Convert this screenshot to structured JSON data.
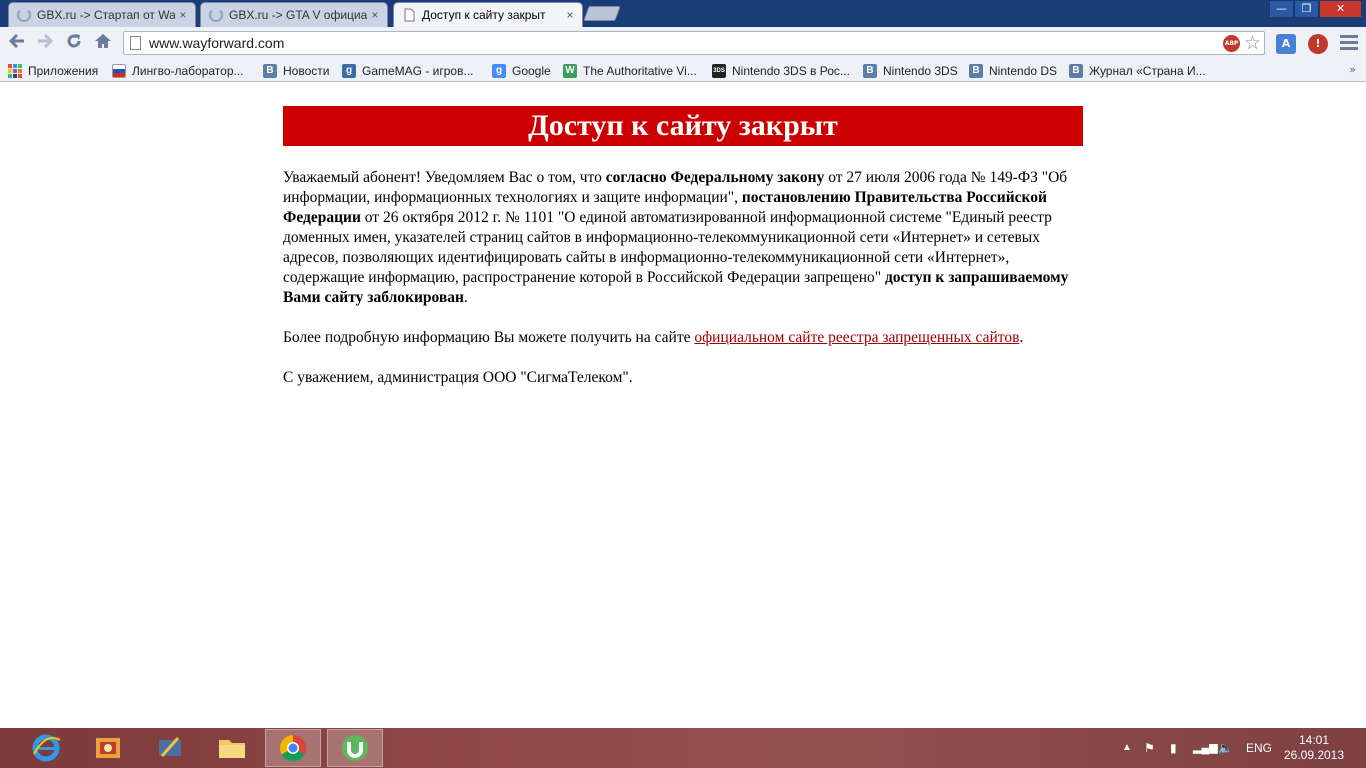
{
  "browser": {
    "tabs": [
      {
        "title": "GBX.ru -> Стартап от Way",
        "active": false,
        "loading": true
      },
      {
        "title": "GBX.ru -> GTA V официал",
        "active": false,
        "loading": true
      },
      {
        "title": "Доступ к сайту закрыт",
        "active": true,
        "loading": false
      }
    ],
    "tab_close_glyph": "×",
    "window_controls": {
      "minimize": "—",
      "maximize": "❐",
      "close": "✕"
    },
    "address_bar": {
      "url": "www.wayforward.com"
    },
    "extensions": {
      "adblock_label": "ABP"
    },
    "bookmarks": [
      {
        "label": "Приложения",
        "icon": "apps-grid-icon"
      },
      {
        "label": "Лингво-лаборатор...",
        "icon": "russian-flag-icon"
      },
      {
        "label": "Новости",
        "icon": "vk-icon"
      },
      {
        "label": "GameMAG - игров...",
        "icon": "gamemag-icon"
      },
      {
        "label": "Google",
        "icon": "google-icon"
      },
      {
        "label": "The Authoritative Vi...",
        "icon": "authoritative-icon"
      },
      {
        "label": "Nintendo 3DS в Рос...",
        "icon": "3ds-icon"
      },
      {
        "label": "Nintendo 3DS",
        "icon": "vk-icon"
      },
      {
        "label": "Nintendo DS",
        "icon": "vk-icon"
      },
      {
        "label": "Журнал «Страна И...",
        "icon": "vk-icon"
      }
    ]
  },
  "page": {
    "banner_title": "Доступ к сайту закрыт",
    "para1": {
      "t1": "Уважаемый абонент! Уведомляем Вас о том, что ",
      "b1": "согласно Федеральному закону",
      "t2": " от 27 июля 2006 года № 149-ФЗ \"Об информации, информационных технологиях и защите информации\", ",
      "b2": "постановлению Правительства Российской Федерации",
      "t3": " от 26 октября 2012 г. № 1101 \"О единой автоматизированной информационной системе \"Единый реестр доменных имен, указателей страниц сайтов в информационно-телекоммуникационной сети «Интернет» и сетевых адресов, позволяющих идентифицировать сайты в информационно-телекоммуникационной сети «Интернет», содержащие информацию, распространение которой в Российской Федерации запрещено\" ",
      "b3": "доступ к запрашиваемому Вами сайту заблокирован",
      "t4": "."
    },
    "para2": {
      "text": "Более подробную информацию Вы можете получить на сайте ",
      "link": "официальном сайте реестра запрещенных сайтов",
      "end": "."
    },
    "para3": "С уважением, администрация ООО \"СигмаТелеком\"."
  },
  "taskbar": {
    "apps": [
      {
        "name": "internet-explorer",
        "active": false
      },
      {
        "name": "utility-app",
        "active": false
      },
      {
        "name": "media-app",
        "active": false
      },
      {
        "name": "file-explorer",
        "active": false
      },
      {
        "name": "chrome",
        "active": true
      },
      {
        "name": "utorrent",
        "active": true
      }
    ],
    "language": "ENG",
    "time": "14:01",
    "date": "26.09.2013"
  },
  "colors": {
    "banner_bg": "#cc0000",
    "link": "#a00000",
    "titlebar": "#1a3d78",
    "taskbar": "#8e4646"
  }
}
